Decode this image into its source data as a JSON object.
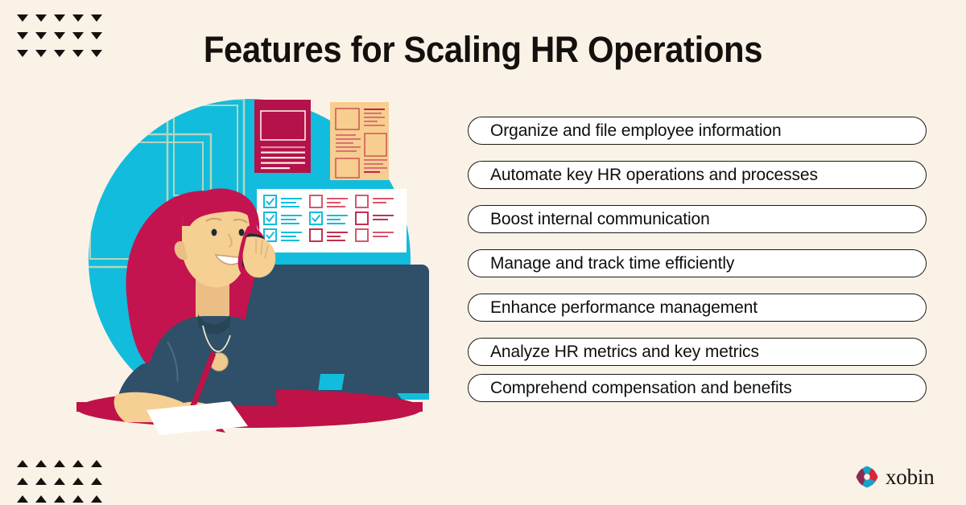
{
  "header": {
    "title": "Features for Scaling HR Operations"
  },
  "colors": {
    "background": "#FAF2E6",
    "cyan": "#12BCDC",
    "crimson": "#BE1248",
    "crimson_deep": "#B5114A",
    "slate": "#2F5068",
    "skin": "#F6CF93",
    "peach": "#F7CE8F",
    "ink": "#14110F",
    "pill_fill": "#FFFFFF",
    "pill_border": "#1B1816"
  },
  "decor": {
    "top_left_pattern": {
      "icon": "triangle-down-icon",
      "columns": 5,
      "rows": 3,
      "count": 15
    },
    "bottom_left_pattern": {
      "icon": "triangle-up-icon",
      "columns": 5,
      "rows": 3,
      "count": 15
    }
  },
  "illustration": {
    "alt": "HR professional on a phone call writing notes at a desk with a monitor, wall documents and a checklist board",
    "elements": [
      "cyan-circle-backdrop",
      "wall-frames",
      "crimson-document",
      "peach-document",
      "checklist-panel",
      "woman-with-phone",
      "desktop-monitor",
      "crimson-desk",
      "white-paper",
      "red-pen"
    ],
    "checklist": {
      "columns": 3,
      "rows": 3,
      "checked": [
        [
          true,
          false,
          false
        ],
        [
          true,
          true,
          false
        ],
        [
          true,
          false,
          false
        ]
      ]
    }
  },
  "features": {
    "items": [
      {
        "label": "Organize and file employee information"
      },
      {
        "label": "Automate key HR operations and processes"
      },
      {
        "label": "Boost internal communication"
      },
      {
        "label": "Manage and track time efficiently"
      },
      {
        "label": "Enhance performance management"
      },
      {
        "label": "Analyze HR metrics and key metrics"
      },
      {
        "label": "Comprehend compensation and benefits"
      }
    ]
  },
  "brand": {
    "name": "xobin",
    "mark": "xobin-logo-icon"
  }
}
